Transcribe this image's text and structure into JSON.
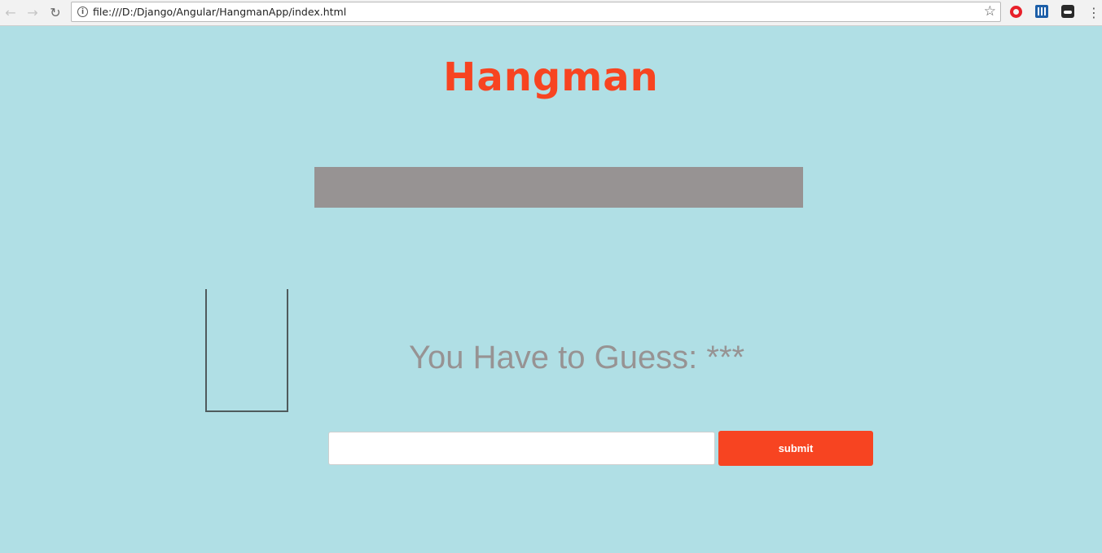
{
  "browser": {
    "url": "file:///D:/Django/Angular/HangmanApp/index.html",
    "icons": {
      "back": "arrow-left-icon",
      "forward": "arrow-right-icon",
      "reload": "reload-icon",
      "info": "info-icon",
      "bookmark": "star-icon",
      "menu": "kebab-menu-icon"
    },
    "extensions": [
      "opera-icon",
      "bar-chart-extension-icon",
      "glasses-extension-icon"
    ]
  },
  "page": {
    "title": "Hangman",
    "guess_prompt": "You Have to Guess: ***",
    "input_value": "",
    "submit_label": "submit"
  },
  "colors": {
    "background": "#b0dfe5",
    "accent": "#f74421",
    "banner": "#979393",
    "prompt_text": "#979393"
  }
}
